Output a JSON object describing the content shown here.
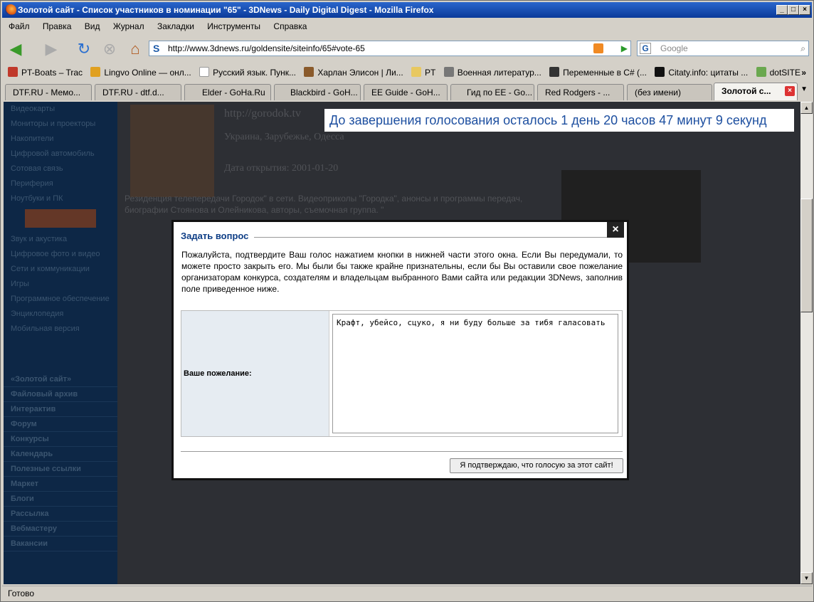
{
  "window": {
    "title": "Золотой сайт - Список участников в номинации \"65\" - 3DNews - Daily Digital Digest - Mozilla Firefox"
  },
  "menu": [
    "Файл",
    "Правка",
    "Вид",
    "Журнал",
    "Закладки",
    "Инструменты",
    "Справка"
  ],
  "nav": {
    "url": "http://www.3dnews.ru/goldensite/siteinfo/65#vote-65",
    "search_placeholder": "Google"
  },
  "bookmarks": [
    {
      "label": "PT-Boats – Trac",
      "color": "#c0392b"
    },
    {
      "label": "Lingvo Online — онл...",
      "color": "#e0a020"
    },
    {
      "label": "Русский язык. Пунк...",
      "color": "#ffffff"
    },
    {
      "label": "Харлан Элисон | Ли...",
      "color": "#8a5a2b"
    },
    {
      "label": "PT",
      "color": "#e8c860"
    },
    {
      "label": "Военная литератур...",
      "color": "#777777"
    },
    {
      "label": "Переменные в C# (...",
      "color": "#333333"
    },
    {
      "label": "Citaty.info: цитаты ...",
      "color": "#111111"
    },
    {
      "label": "dotSITE",
      "color": "#6aa84f"
    }
  ],
  "tabs": [
    "DTF.RU - Мемо...",
    "DTF.RU - dtf.d...",
    "Elder - GoHa.Ru",
    "Blackbird - GoH...",
    "EE Guide - GoH...",
    "Гид по EE - Go...",
    "Red Rodgers - ...",
    "(без имени)",
    "Золотой с..."
  ],
  "page": {
    "timer": "До завершения голосования осталось 1 день 20 часов 47 минут 9 секунд",
    "sidebar": [
      "Видеокарты",
      "Мониторы и проекторы",
      "Накопители",
      "Цифровой автомобиль",
      "Сотовая связь",
      "Периферия",
      "Ноутбуки и ПК",
      "",
      "Звук и акустика",
      "Цифровое фото и видео",
      "Сети и коммуникации",
      "Игры",
      "Программное обеспечение",
      "Энциклопедия",
      "Мобильная версия"
    ],
    "sidebar_bold": [
      "«Золотой сайт»",
      "Файловый архив",
      "Интерактив",
      "Форум",
      "Конкурсы",
      "Календарь",
      "Полезные ссылки",
      "Маркет",
      "Блоги",
      "Рассылка",
      "Вебмастеру",
      "Вакансии"
    ],
    "site_url": "http://gorodok.tv",
    "region": "Украина, Зарубежье, Одесса",
    "opened": "Дата открытия: 2001-01-20",
    "description": "Резиденция телепередачи Городок\" в сети. Видеоприколы \"Городка\", анонсы и программы передач, биографии Стоянова и Олейникова, авторы, съемочная группа. \""
  },
  "dialog": {
    "title": "Задать вопрос",
    "close": "×",
    "text": "Пожалуйста, подтвердите Ваш голос нажатием кнопки в нижней части этого окна. Если Вы передумали, то можете просто закрыть его. Мы были бы также крайне признательны, если бы Вы оставили свое пожелание организаторам конкурса, создателям и владельцам выбранного Вами сайта или редакции 3DNews, заполнив поле приведенное ниже.",
    "label": "Ваше пожелание:",
    "wish": "Крафт, убейсо, сцуко, я ни буду больше за тибя галасовать",
    "button": "Я подтверждаю, что голосую за этот сайт!"
  },
  "status": "Готово"
}
